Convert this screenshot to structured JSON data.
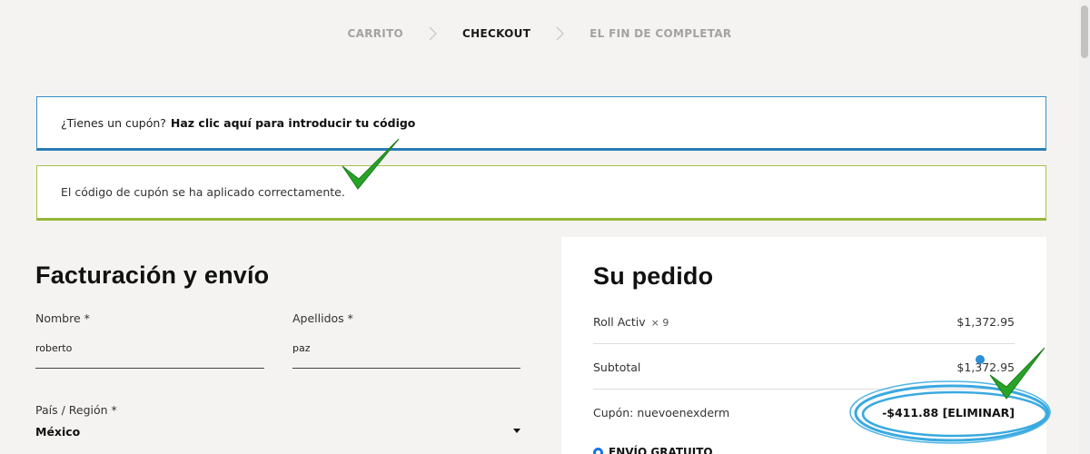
{
  "breadcrumb": {
    "steps": [
      "CARRITO",
      "CHECKOUT",
      "EL FIN DE COMPLETAR"
    ],
    "active_index": 1,
    "separator_icon": "chevron-right-icon"
  },
  "coupon_notice": {
    "prompt": "¿Tienes un cupón?",
    "link": "Haz clic aquí para introducir tu código",
    "accent": "#2a7db3"
  },
  "success_notice": {
    "message": "El código de cupón se ha aplicado correctamente.",
    "accent": "#94b63a"
  },
  "billing": {
    "title": "Facturación y envío",
    "first_name": {
      "label": "Nombre *",
      "value": "roberto"
    },
    "last_name": {
      "label": "Apellidos *",
      "value": "paz"
    },
    "country": {
      "label": "País / Región *",
      "value": "México"
    }
  },
  "order": {
    "title": "Su pedido",
    "item": {
      "name": "Roll Activ",
      "qty": "× 9",
      "price": "$1,372.95"
    },
    "subtotal": {
      "label": "Subtotal",
      "value": "$1,372.95"
    },
    "coupon": {
      "label": "Cupón: nuevoenexderm",
      "value": "-$411.88",
      "remove": "[ELIMINAR]"
    },
    "shipping": {
      "label": "ENVÍO GRATUITO"
    }
  },
  "annotations": {
    "checkmark_color": "#22a022",
    "highlight_color": "#3aa9e0"
  }
}
